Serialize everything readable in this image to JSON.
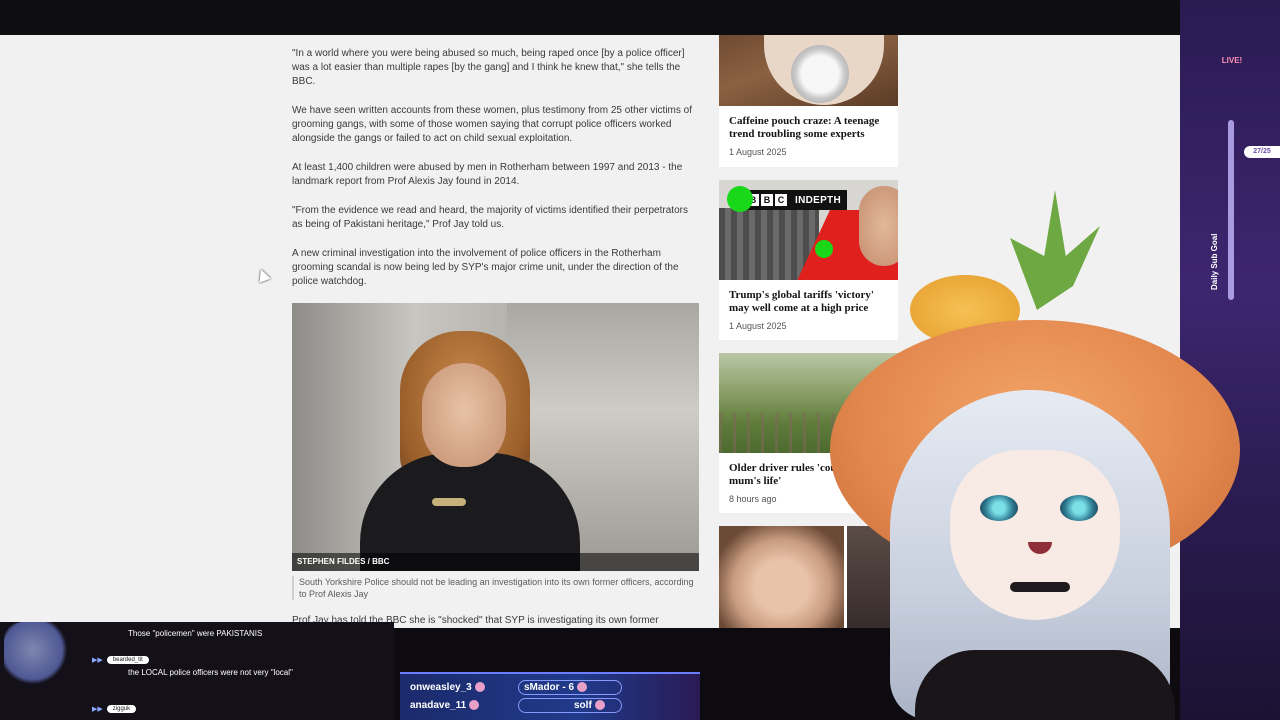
{
  "article": {
    "paragraphs": [
      "\"In a world where you were being abused so much, being raped once [by a police officer] was a lot easier than multiple rapes [by the gang] and I think he knew that,\" she tells the BBC.",
      "We have seen written accounts from these women, plus testimony from 25 other victims of grooming gangs, with some of those women saying that corrupt police officers worked alongside the gangs or failed to act on child sexual exploitation.",
      "At least 1,400 children were abused by men in Rotherham between 1997 and 2013 - the landmark report from Prof Alexis Jay found in 2014.",
      "\"From the evidence we read and heard, the majority of victims identified their perpetrators as being of Pakistani heritage,\" Prof Jay told us.",
      "A new criminal investigation into the involvement of police officers in the Rotherham grooming scandal is now being led by SYP's major crime unit, under the direction of the police watchdog."
    ],
    "photo_credit": "STEPHEN FILDES / BBC",
    "caption": "South Yorkshire Police should not be leading an investigation into its own former officers, according to Prof Alexis Jay",
    "cut_paragraph": "Prof Jay has told the BBC she is \"shocked\" that SYP is investigating its own former"
  },
  "sidebar": {
    "cards": [
      {
        "headline": "Caffeine pouch craze: A teenage trend troubling some experts",
        "date": "1 August 2025"
      },
      {
        "headline": "Trump's global tariffs 'victory' may well come at a high price",
        "date": "1 August 2025",
        "tag_letters": [
          "B",
          "B",
          "C"
        ],
        "tag_text": "INDEPTH"
      },
      {
        "headline": "Older driver rules 'cou saved mum's life'",
        "date": "8 hours ago"
      }
    ]
  },
  "stream": {
    "live_label": "LIVE!",
    "sub_count": "27/25",
    "goal_label": "Daily Sub Goal"
  },
  "chat": {
    "messages": [
      {
        "user": "",
        "text": "Those \"policemen\" were PAKISTANIS"
      },
      {
        "user": "bearded_tit",
        "text": "the LOCAL police officers were not very \"local\""
      },
      {
        "user": "zigguk",
        "text": ""
      }
    ]
  },
  "subs": {
    "names": [
      "onweasley_3",
      "sMador - 6",
      "anadave_11",
      "solf"
    ]
  },
  "colors": {
    "bbc_red": "#e0201d",
    "indepth_green": "#19d81a",
    "stream_purple": "#3d2670"
  }
}
